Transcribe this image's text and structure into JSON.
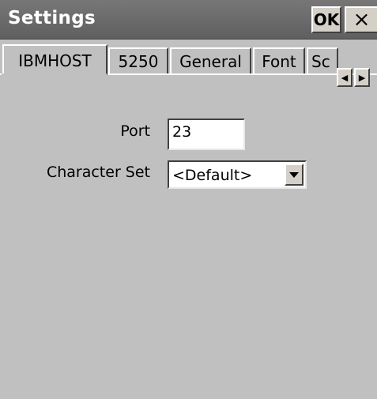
{
  "window": {
    "title": "Settings",
    "ok_label": "OK",
    "close_label": "×"
  },
  "tabs": [
    {
      "label": "IBMHOST",
      "active": true
    },
    {
      "label": "5250",
      "active": false
    },
    {
      "label": "General",
      "active": false
    },
    {
      "label": "Font",
      "active": false
    },
    {
      "label": "Sc",
      "active": false
    }
  ],
  "tab_scroll": {
    "left_icon": "◀",
    "right_icon": "▶"
  },
  "form": {
    "port_label": "Port",
    "port_value": "23",
    "charset_label": "Character Set",
    "charset_value": "<Default>"
  }
}
